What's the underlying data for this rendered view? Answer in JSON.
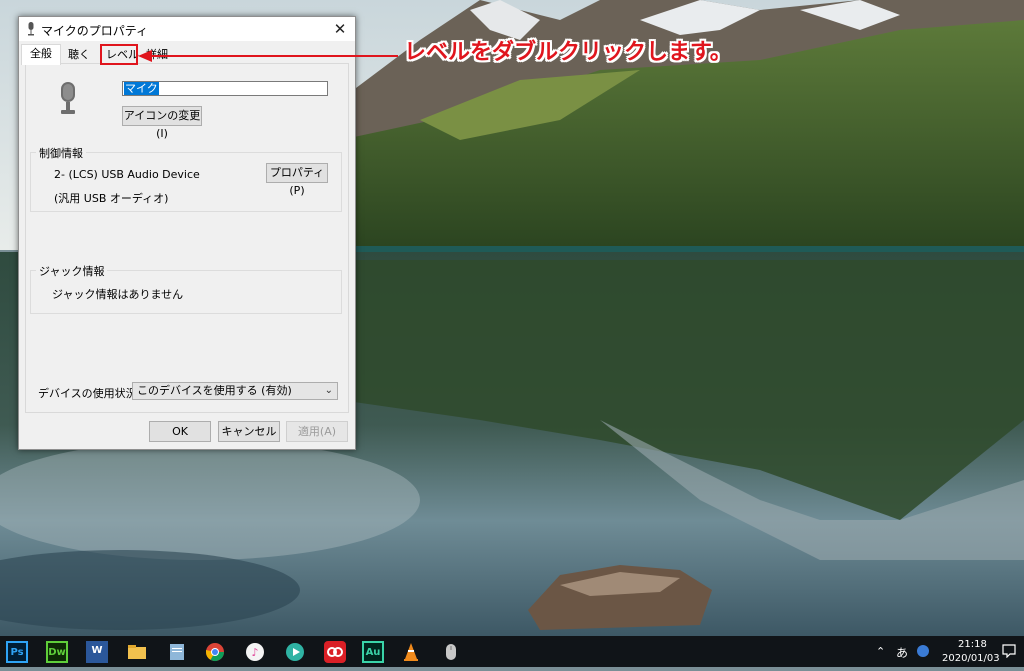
{
  "dialog": {
    "title": "マイクのプロパティ",
    "close_glyph": "✕",
    "tabs": [
      {
        "label": "全般"
      },
      {
        "label": "聴く"
      },
      {
        "label": "レベル"
      },
      {
        "label": "詳細"
      }
    ],
    "device_name_value": "マイク",
    "change_icon_label": "アイコンの変更(I)",
    "controller": {
      "group_label": "制御情報",
      "device_line": "2- (LCS) USB Audio Device",
      "driver_line": "(汎用 USB オーディオ)",
      "properties_label": "プロパティ(P)"
    },
    "jack": {
      "group_label": "ジャック情報",
      "info": "ジャック情報はありません"
    },
    "device_usage": {
      "label": "デバイスの使用状況:",
      "selected": "このデバイスを使用する (有効)"
    },
    "ok_label": "OK",
    "cancel_label": "キャンセル",
    "apply_label": "適用(A)"
  },
  "annotation": {
    "text": "レベルをダブルクリックします。",
    "color": "#e0151d"
  },
  "taskbar": {
    "apps": [
      {
        "label": "Ps",
        "icon": "photoshop-icon"
      },
      {
        "label": "Dw",
        "icon": "dreamweaver-icon"
      },
      {
        "label": "W",
        "icon": "word-icon"
      },
      {
        "label": "",
        "icon": "file-explorer-icon"
      },
      {
        "label": "",
        "icon": "notepad-icon"
      },
      {
        "label": "",
        "icon": "chrome-icon"
      },
      {
        "label": "",
        "icon": "itunes-icon"
      },
      {
        "label": "",
        "icon": "media-player-icon"
      },
      {
        "label": "",
        "icon": "creative-cloud-icon"
      },
      {
        "label": "Au",
        "icon": "audition-icon"
      },
      {
        "label": "",
        "icon": "vlc-icon"
      },
      {
        "label": "",
        "icon": "mouse-icon"
      }
    ],
    "ime": "あ",
    "time": "21:18",
    "date": "2020/01/03"
  }
}
